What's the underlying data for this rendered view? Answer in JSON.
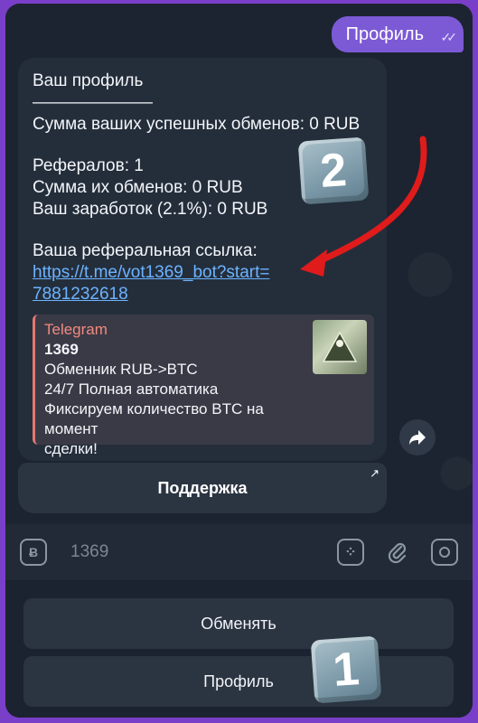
{
  "outgoing_message": {
    "text": "Профиль"
  },
  "profile_message": {
    "lines": [
      "Ваш профиль",
      "———————",
      "Сумма ваших успешных обменов: 0 RUB",
      "Рефералов: 1",
      "Сумма их обменов: 0 RUB",
      "Ваш заработок (2.1%): 0 RUB",
      "Ваша реферальная ссылка:"
    ],
    "link_line1": "https://t.me/vot1369_bot?start=",
    "link_line2": "7881232618"
  },
  "link_preview": {
    "site": "Telegram",
    "title": "1369",
    "desc_line1": "Обменник RUB->BTC",
    "desc_line2": "24/7 Полная автоматика",
    "desc_line3": "Фиксируем количество BTC на момент",
    "desc_line4": "сделки!"
  },
  "inline_button": {
    "label": "Поддержка"
  },
  "input_bar": {
    "placeholder": "1369",
    "left_icon": "bitcoin-icon"
  },
  "keyboard": {
    "buttons": [
      "Обменять",
      "Профиль"
    ]
  },
  "badges": {
    "one": "1",
    "two": "2"
  },
  "colors": {
    "accent": "#7c5ad6",
    "link": "#6cb3ff",
    "arrow": "#e01b1b"
  }
}
